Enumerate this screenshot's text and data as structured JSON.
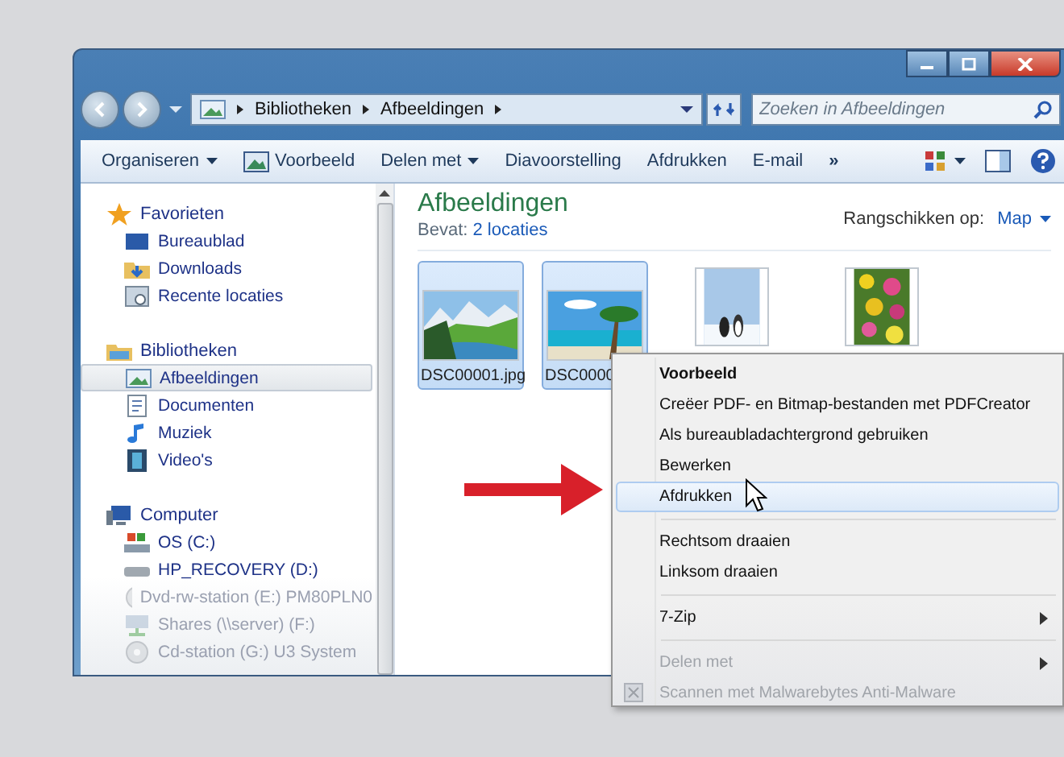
{
  "address": {
    "crumbs": [
      "Bibliotheken",
      "Afbeeldingen"
    ]
  },
  "search": {
    "placeholder": "Zoeken in Afbeeldingen"
  },
  "toolbar": [
    {
      "label": "Organiseren",
      "dropdown": true
    },
    {
      "label": "Voorbeeld",
      "dropdown": false
    },
    {
      "label": "Delen met",
      "dropdown": true
    },
    {
      "label": "Diavoorstelling",
      "dropdown": false
    },
    {
      "label": "Afdrukken",
      "dropdown": false
    },
    {
      "label": "E-mail",
      "dropdown": false
    },
    {
      "label": "»",
      "dropdown": false
    }
  ],
  "sidebar": [
    {
      "label": "Favorieten",
      "selected": false,
      "faded": false,
      "children": [
        {
          "label": "Bureaublad",
          "selected": false,
          "faded": false
        },
        {
          "label": "Downloads",
          "selected": false,
          "faded": false
        },
        {
          "label": "Recente locaties",
          "selected": false,
          "faded": false
        }
      ]
    },
    {
      "label": "Bibliotheken",
      "selected": false,
      "faded": false,
      "children": [
        {
          "label": "Afbeeldingen",
          "selected": true,
          "faded": false
        },
        {
          "label": "Documenten",
          "selected": false,
          "faded": false
        },
        {
          "label": "Muziek",
          "selected": false,
          "faded": false
        },
        {
          "label": "Video's",
          "selected": false,
          "faded": false
        }
      ]
    },
    {
      "label": "Computer",
      "selected": false,
      "faded": false,
      "children": [
        {
          "label": "OS (C:)",
          "selected": false,
          "faded": false
        },
        {
          "label": "HP_RECOVERY (D:)",
          "selected": false,
          "faded": false
        },
        {
          "label": "Dvd-rw-station (E:) PM80PLN0",
          "selected": false,
          "faded": true
        },
        {
          "label": "Shares (\\\\server) (F:)",
          "selected": false,
          "faded": true
        },
        {
          "label": "Cd-station (G:) U3 System",
          "selected": false,
          "faded": true
        }
      ]
    }
  ],
  "main": {
    "title": "Afbeeldingen",
    "contains_label": "Bevat:",
    "contains_link": "2 locaties",
    "arrange_label": "Rangschikken op:",
    "arrange_value": "Map"
  },
  "files": [
    {
      "name": "DSC00001.jpg",
      "selected": true
    },
    {
      "name": "DSC0000",
      "selected": true
    },
    {
      "selected": false
    },
    {
      "selected": false
    }
  ],
  "context_menu": {
    "groups": [
      [
        {
          "label": "Voorbeeld",
          "bold": true,
          "selected": false,
          "submenu": false,
          "faded": false,
          "has_icon": false
        },
        {
          "label": "Creëer PDF- en Bitmap-bestanden met PDFCreator",
          "bold": false,
          "selected": false,
          "submenu": false,
          "faded": false,
          "has_icon": false
        },
        {
          "label": "Als bureaubladachtergrond gebruiken",
          "bold": false,
          "selected": false,
          "submenu": false,
          "faded": false,
          "has_icon": false
        },
        {
          "label": "Bewerken",
          "bold": false,
          "selected": false,
          "submenu": false,
          "faded": false,
          "has_icon": false
        },
        {
          "label": "Afdrukken",
          "bold": false,
          "selected": true,
          "submenu": false,
          "faded": false,
          "has_icon": false
        }
      ],
      [
        {
          "label": "Rechtsom draaien",
          "bold": false,
          "selected": false,
          "submenu": false,
          "faded": false,
          "has_icon": false
        },
        {
          "label": "Linksom draaien",
          "bold": false,
          "selected": false,
          "submenu": false,
          "faded": false,
          "has_icon": false
        }
      ],
      [
        {
          "label": "7-Zip",
          "bold": false,
          "selected": false,
          "submenu": true,
          "faded": false,
          "has_icon": false
        }
      ],
      [
        {
          "label": "Delen met",
          "bold": false,
          "selected": false,
          "submenu": true,
          "faded": true,
          "has_icon": false
        },
        {
          "label": "Scannen met Malwarebytes Anti-Malware",
          "bold": false,
          "selected": false,
          "submenu": false,
          "faded": true,
          "has_icon": true
        }
      ]
    ]
  }
}
